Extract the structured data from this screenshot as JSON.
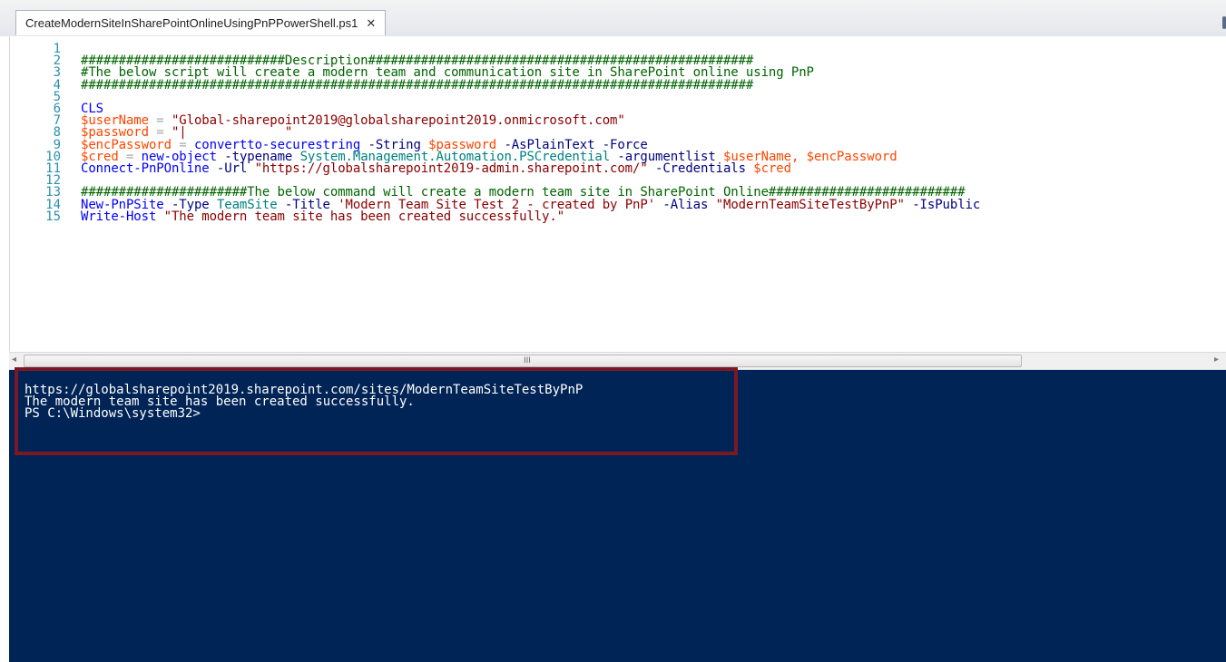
{
  "tab": {
    "title": "CreateModernSiteInSharePointOnlineUsingPnPPowerShell.ps1",
    "close": "✕"
  },
  "editor": {
    "line_numbers": [
      "1",
      "2",
      "3",
      "4",
      "5",
      "6",
      "7",
      "8",
      "9",
      "10",
      "11",
      "12",
      "13",
      "14",
      "15"
    ],
    "lines": [
      [],
      [
        [
          "c-cmt",
          "###########################Description###################################################"
        ]
      ],
      [
        [
          "c-cmt",
          "#The below script will create a modern team and communication site in SharePoint online using PnP"
        ]
      ],
      [
        [
          "c-cmt",
          "#########################################################################################"
        ]
      ],
      [],
      [
        [
          "c-cmd",
          "CLS"
        ]
      ],
      [
        [
          "c-var",
          "$userName"
        ],
        [
          "c-op",
          " = "
        ],
        [
          "c-str",
          "\"Global-sharepoint2019@globalsharepoint2019.onmicrosoft.com\""
        ]
      ],
      [
        [
          "c-var",
          "$password"
        ],
        [
          "c-op",
          " = "
        ],
        [
          "c-str",
          "\"|             \""
        ]
      ],
      [
        [
          "c-var",
          "$encPassword"
        ],
        [
          "c-op",
          " = "
        ],
        [
          "c-cmd",
          "convertto-securestring"
        ],
        [
          "c-param",
          " -String "
        ],
        [
          "c-var",
          "$password"
        ],
        [
          "c-param",
          " -AsPlainText -Force"
        ]
      ],
      [
        [
          "c-var",
          "$cred"
        ],
        [
          "c-op",
          " = "
        ],
        [
          "c-cmd",
          "new-object"
        ],
        [
          "c-param",
          " -typename "
        ],
        [
          "c-type",
          "System.Management.Automation.PSCredential"
        ],
        [
          "c-param",
          " -argumentlist "
        ],
        [
          "c-var",
          "$userName, $encPassword"
        ]
      ],
      [
        [
          "c-cmd",
          "Connect-PnPOnline"
        ],
        [
          "c-param",
          " -Url "
        ],
        [
          "c-str",
          "\"https://globalsharepoint2019-admin.sharepoint.com/\""
        ],
        [
          "c-param",
          " -Credentials "
        ],
        [
          "c-var",
          "$cred"
        ]
      ],
      [],
      [
        [
          "c-cmt",
          "######################The below command will create a modern team site in SharePoint Online##########################"
        ]
      ],
      [
        [
          "c-cmd",
          "New-PnPSite"
        ],
        [
          "c-param",
          " -Type "
        ],
        [
          "c-type",
          "TeamSite"
        ],
        [
          "c-param",
          " -Title "
        ],
        [
          "c-str",
          "'Modern Team Site Test 2 - created by PnP'"
        ],
        [
          "c-param",
          " -Alias "
        ],
        [
          "c-str",
          "\"ModernTeamSiteTestByPnP\""
        ],
        [
          "c-param",
          " -IsPublic"
        ]
      ],
      [
        [
          "c-cmd",
          "Write-Host"
        ],
        [
          "c-str",
          " \"The modern team site has been created successfully.\""
        ]
      ]
    ]
  },
  "scrollbar": {
    "left_arrow": "◂",
    "right_arrow": "▸",
    "grip": "III"
  },
  "console": {
    "lines": [
      "https://globalsharepoint2019.sharepoint.com/sites/ModernTeamSiteTestByPnP",
      "The modern team site has been created successfully.",
      "PS C:\\Windows\\system32>"
    ]
  },
  "colors": {
    "console_bg": "#012456",
    "highlight_border": "#7b1823",
    "comment": "#006400",
    "command": "#0000ff",
    "variable": "#ff4500",
    "string": "#8b0000"
  }
}
